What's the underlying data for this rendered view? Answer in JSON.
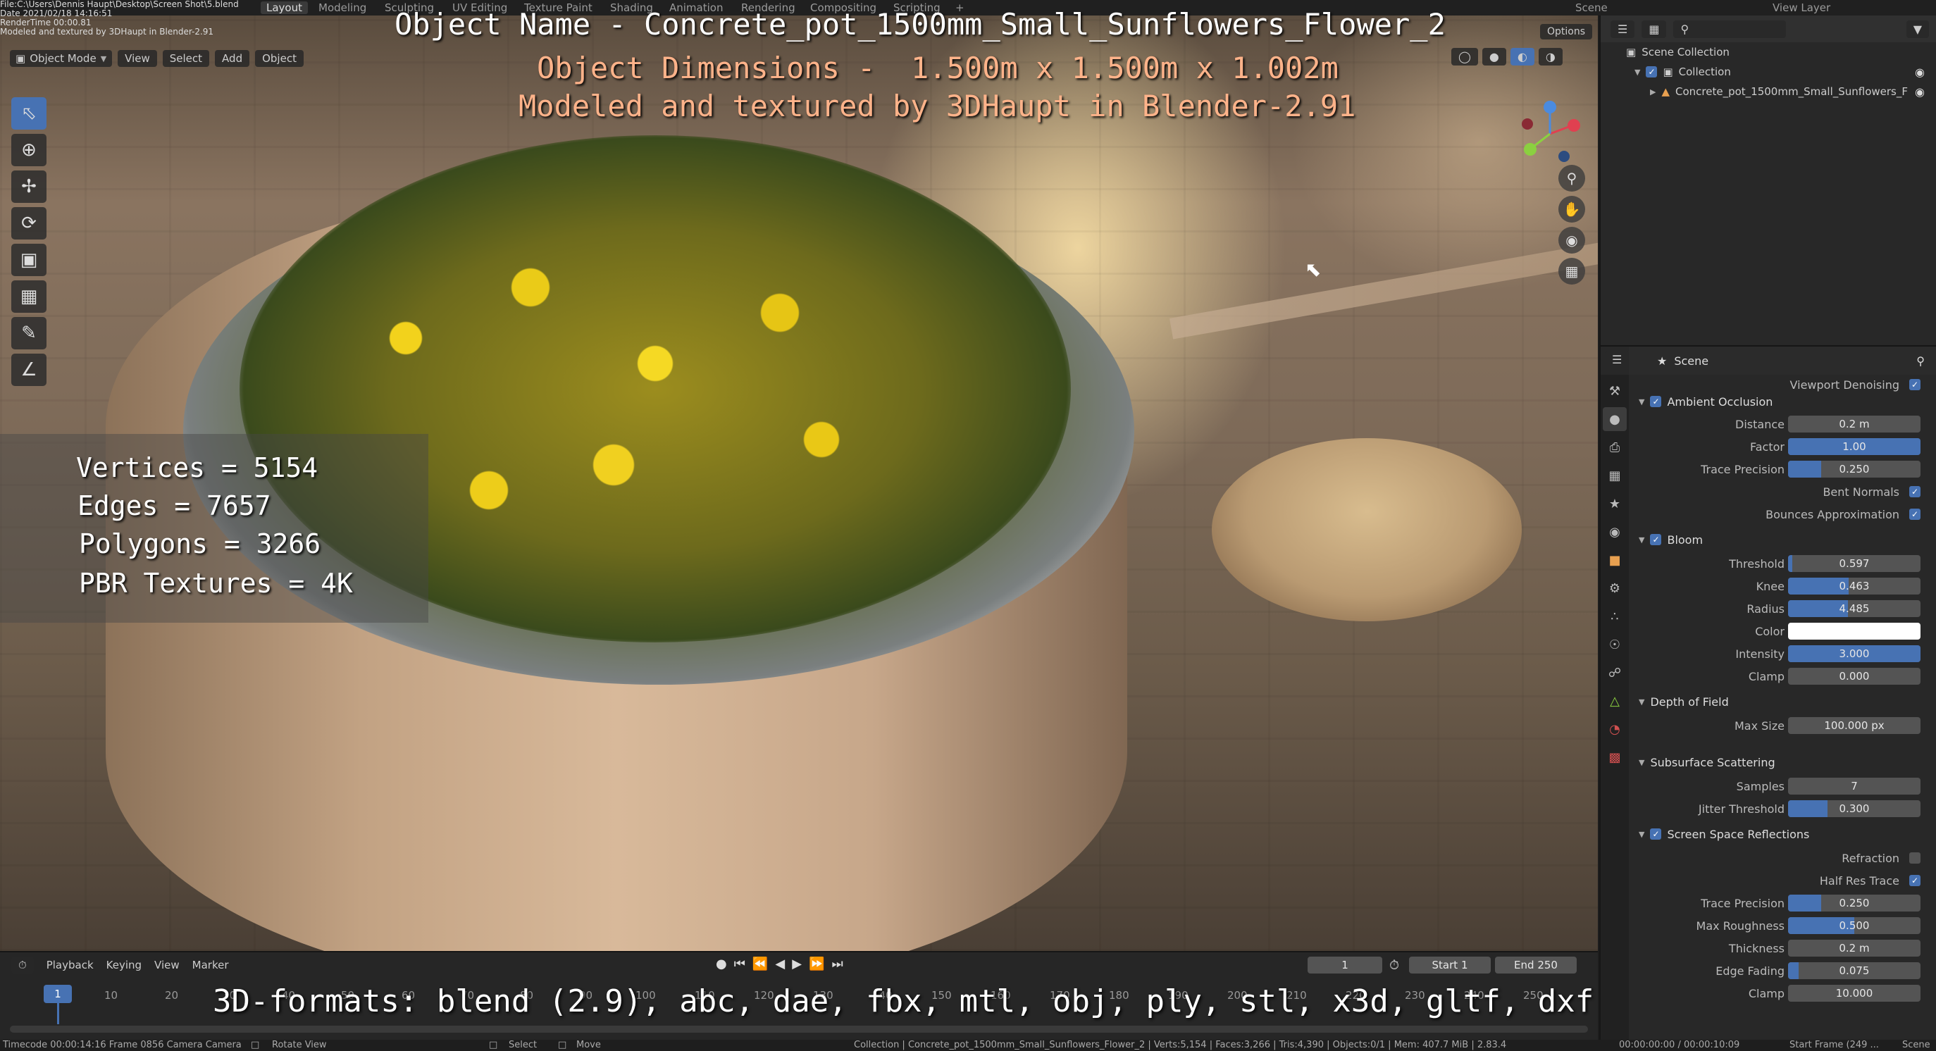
{
  "topbar": {
    "workspaces": [
      "Layout",
      "Modeling",
      "Sculpting",
      "UV Editing",
      "Texture Paint",
      "Shading",
      "Animation",
      "Rendering",
      "Compositing",
      "Scripting"
    ],
    "scene_label": "Scene",
    "view_layer_label": "View Layer"
  },
  "file_overlay": {
    "line1": "File:C:\\Users\\Dennis Haupt\\Desktop\\Screen Shot\\5.blend",
    "line2": "Date 2021/02/18 14:16:51",
    "line3": "RenderTime 00:00.81",
    "line4": "Modeled and textured by 3DHaupt in Blender-2.91"
  },
  "viewport_header": {
    "mode": "Object Mode",
    "menus": [
      "View",
      "Select",
      "Add",
      "Object"
    ],
    "options": "Options"
  },
  "overlay": {
    "object_name": "Object Name - Concrete_pot_1500mm_Small_Sunflowers_Flower_2",
    "dimensions": "Object Dimensions -  1.500m x 1.500m x 1.002m",
    "credit": "Modeled and textured by 3DHaupt in Blender-2.91",
    "stats": [
      "Vertices = 5154",
      "Edges = 7657",
      "Polygons = 3266",
      "PBR Textures = 4K"
    ],
    "formats": "3D-formats: blend (2.9), abc, dae, fbx, mtl, obj, ply, stl, x3d, gltf, dxf"
  },
  "outliner": {
    "scene_collection": "Scene Collection",
    "collection": "Collection",
    "object": "Concrete_pot_1500mm_Small_Sunflowers_F"
  },
  "properties": {
    "header": "Scene",
    "viewport_denoising": "Viewport Denoising",
    "sections": {
      "ao": "Ambient Occlusion",
      "bloom": "Bloom",
      "dof": "Depth of Field",
      "sss": "Subsurface Scattering",
      "ssr": "Screen Space Reflections"
    },
    "ao": {
      "distance_label": "Distance",
      "distance": "0.2 m",
      "factor_label": "Factor",
      "factor": "1.00",
      "trace_label": "Trace Precision",
      "trace": "0.250",
      "bent_label": "Bent Normals",
      "bounces_label": "Bounces Approximation"
    },
    "bloom": {
      "threshold_label": "Threshold",
      "threshold": "0.597",
      "knee_label": "Knee",
      "knee": "0.463",
      "radius_label": "Radius",
      "radius": "4.485",
      "color_label": "Color",
      "intensity_label": "Intensity",
      "intensity": "3.000",
      "clamp_label": "Clamp",
      "clamp": "0.000"
    },
    "dof": {
      "maxsize_label": "Max Size",
      "maxsize": "100.000 px"
    },
    "sss": {
      "samples_label": "Samples",
      "samples": "7",
      "jitter_label": "Jitter Threshold",
      "jitter": "0.300"
    },
    "ssr": {
      "refraction_label": "Refraction",
      "halfres_label": "Half Res Trace",
      "trace_label": "Trace Precision",
      "trace": "0.250",
      "roughness_label": "Max Roughness",
      "roughness": "0.500",
      "thickness_label": "Thickness",
      "thickness": "0.2 m",
      "fading_label": "Edge Fading",
      "fading": "0.075",
      "clamp_label": "Clamp",
      "clamp": "10.000"
    }
  },
  "timeline": {
    "menus": [
      "Playback",
      "Keying",
      "View",
      "Marker"
    ],
    "current_frame": "1",
    "start_label": "Start",
    "start": "1",
    "end_label": "End",
    "end": "250",
    "ticks": [
      "10",
      "20",
      "30",
      "40",
      "50",
      "60",
      "70",
      "80",
      "90",
      "100",
      "110",
      "120",
      "130",
      "140",
      "150",
      "160",
      "170",
      "180",
      "190",
      "200",
      "210",
      "220",
      "230",
      "240",
      "250"
    ]
  },
  "statusbar": {
    "left": "Timecode 00:00:14:16   Frame 0856   Camera Camera",
    "rotate": "Rotate View",
    "select": "Select",
    "move": "Move",
    "info": "Collection | Concrete_pot_1500mm_Small_Sunflowers_Flower_2 | Verts:5,154 | Faces:3,266 | Tris:4,390 | Objects:0/1 | Mem: 407.7 MiB | 2.83.4",
    "time": "00:00:00:00 / 00:00:10:09",
    "start_frame": "Start Frame (249 ...",
    "scene": "Scene"
  },
  "colors": {
    "accent": "#4772b3",
    "overlay_title": "#ffffff",
    "overlay_subtitle": "#ffb38a"
  }
}
